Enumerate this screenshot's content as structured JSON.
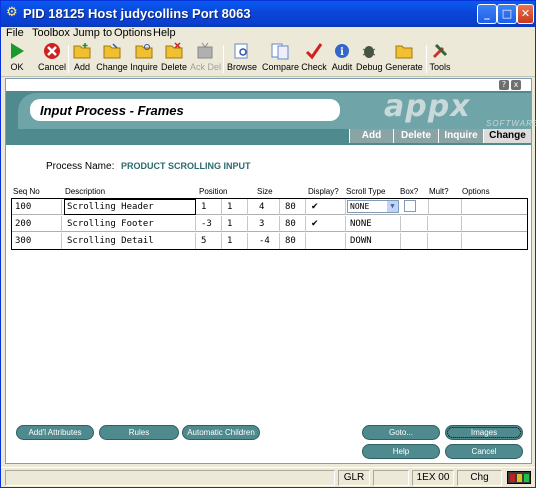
{
  "window": {
    "title": "PID 18125 Host judycollins Port 8063",
    "controls": [
      "minimize",
      "maximize",
      "close"
    ]
  },
  "menu": [
    "File",
    "Toolbox",
    "Jump to",
    "Options",
    "Help"
  ],
  "toolbar": [
    {
      "label": "OK",
      "icon": "play-icon",
      "color": "#1a9a2a",
      "enabled": true
    },
    {
      "label": "Cancel",
      "icon": "cancel-icon",
      "color": "#d02020",
      "enabled": true
    },
    {
      "label": "Add",
      "icon": "folder-add-icon",
      "color": "#f0c030",
      "enabled": true
    },
    {
      "label": "Change",
      "icon": "folder-change-icon",
      "color": "#f0c030",
      "enabled": true
    },
    {
      "label": "Inquire",
      "icon": "folder-inquire-icon",
      "color": "#f0c030",
      "enabled": true
    },
    {
      "label": "Delete",
      "icon": "folder-delete-icon",
      "color": "#f0c030",
      "enabled": true
    },
    {
      "label": "Ack Del",
      "icon": "tv-icon",
      "color": "#a0a0a0",
      "enabled": false
    },
    {
      "label": "Browse",
      "icon": "browse-icon",
      "color": "#6688cc",
      "enabled": true
    },
    {
      "label": "Compare",
      "icon": "compare-icon",
      "color": "#6688cc",
      "enabled": true
    },
    {
      "label": "Check",
      "icon": "checkmark-icon",
      "color": "#d02020",
      "enabled": true
    },
    {
      "label": "Audit",
      "icon": "info-icon",
      "color": "#3366cc",
      "enabled": true
    },
    {
      "label": "Debug",
      "icon": "bug-icon",
      "color": "#445544",
      "enabled": true
    },
    {
      "label": "Generate",
      "icon": "folder-generate-icon",
      "color": "#f0c030",
      "enabled": true
    },
    {
      "label": "Tools",
      "icon": "tools-icon",
      "color": "#cc3333",
      "enabled": true
    }
  ],
  "banner": {
    "title": "Input Process - Frames",
    "logo": "appx",
    "logo_sub": "SOFTWARE",
    "help": "?",
    "close": "x",
    "modes": [
      "Add",
      "Delete",
      "Inquire",
      "Change"
    ],
    "active_mode": "Change"
  },
  "process": {
    "label": "Process Name:",
    "value": "PRODUCT SCROLLING INPUT"
  },
  "columns": [
    "Seq No",
    "Description",
    "Position",
    "Size",
    "Display?",
    "Scroll Type",
    "Box?",
    "Mult?",
    "Options"
  ],
  "rows": [
    {
      "seq": "100",
      "desc": "Scrolling Header",
      "pos1": "1",
      "pos2": "1",
      "size1": "4",
      "size2": "80",
      "display": "✔",
      "scroll": "NONE",
      "box": ""
    },
    {
      "seq": "200",
      "desc": "Scrolling Footer",
      "pos1": "-3",
      "pos2": "1",
      "size1": "3",
      "size2": "80",
      "display": "✔",
      "scroll": "NONE",
      "box": ""
    },
    {
      "seq": "300",
      "desc": "Scrolling Detail",
      "pos1": "5",
      "pos2": "1",
      "size1": "-4",
      "size2": "80",
      "display": "",
      "scroll": "DOWN",
      "box": ""
    }
  ],
  "buttons": {
    "addl": "Add'l Attributes",
    "rules": "Rules",
    "auto_children": "Automatic Children",
    "goto": "Goto...",
    "images": "Images",
    "help": "Help",
    "cancel": "Cancel"
  },
  "status": {
    "glr": "GLR",
    "code": "1EX 00",
    "mode": "Chg"
  }
}
